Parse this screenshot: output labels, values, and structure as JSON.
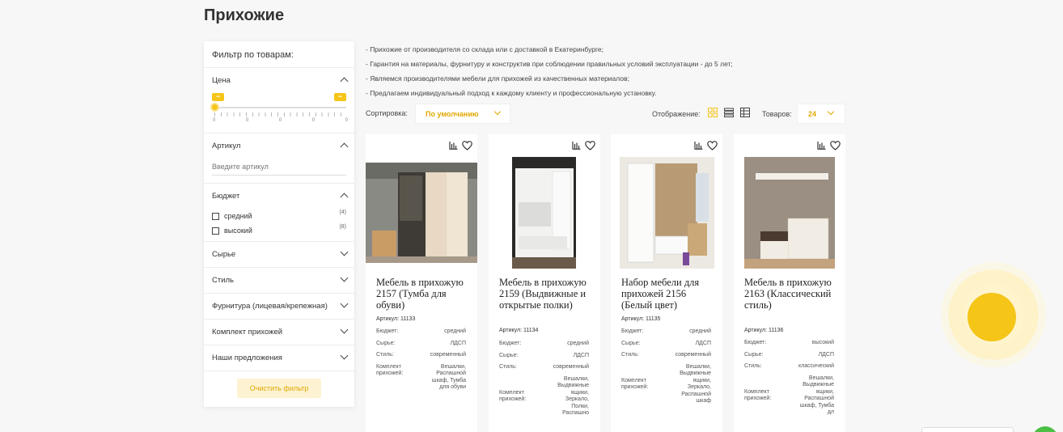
{
  "page": {
    "title": "Прихожие"
  },
  "filter": {
    "title": "Фильтр по товарам:",
    "price": {
      "label": "Цена",
      "min_tag": "▪▪",
      "max_tag": "▪▪",
      "tick_labels": [
        "0",
        "0",
        "0",
        "0",
        "0"
      ]
    },
    "sku": {
      "label": "Артикул",
      "placeholder": "Введите артикул"
    },
    "budget": {
      "label": "Бюджет",
      "options": [
        {
          "label": "средний",
          "count": "(4)"
        },
        {
          "label": "высокий",
          "count": "(8)"
        }
      ]
    },
    "collapsed_sections": [
      "Сырье",
      "Стиль",
      "Фурнитура (лицевая/крепежная)",
      "Комплект прихожей",
      "Наши предложения"
    ],
    "clear_label": "Очистить фильтр"
  },
  "description": [
    "- Прихожие от производителя со склада или с доставкой в Екатеринбурге;",
    "- Гарантия на материалы, фурнитуру и конструктив при соблюдении правильных условий эксплуатации - до 5 лет;",
    "- Являемся производителями мебели для прихожей из качественных материалов;",
    "- Предлагаем индивидуальный подход к каждому клиенту и профессиональную установку."
  ],
  "toolbar": {
    "sort_label": "Сортировка:",
    "sort_value": "По умолчанию",
    "view_label": "Отображение:",
    "per_page_label": "Товаров:",
    "per_page_value": "24"
  },
  "colors": {
    "accent": "#f5c518",
    "accent_text": "#e0a800"
  },
  "products": [
    {
      "name": "Мебель в прихожую 2157 (Тумба для обуви)",
      "sku": "Артикул: 11133",
      "props": [
        {
          "k": "Бюджет:",
          "v": "средний"
        },
        {
          "k": "Сырье:",
          "v": "ЛДСП"
        },
        {
          "k": "Стиль:",
          "v": "современный"
        },
        {
          "k": "Комплект прихожей:",
          "v": "Вешалки, Распашной шкаф, Тумба для обуви"
        }
      ]
    },
    {
      "name": "Мебель в прихожую 2159 (Выдвижные и открытые полки)",
      "sku": "Артикул: 11134",
      "props": [
        {
          "k": "Бюджет:",
          "v": "средний"
        },
        {
          "k": "Сырье:",
          "v": "ЛДСП"
        },
        {
          "k": "Стиль:",
          "v": "современный"
        },
        {
          "k": "Комплект прихожей:",
          "v": "Вешалки, Выдвижные ящики, Зеркало, Полки, Распашно"
        }
      ]
    },
    {
      "name": "Набор мебели для прихожей 2156 (Белый цвет)",
      "sku": "Артикул: 11135",
      "props": [
        {
          "k": "Бюджет:",
          "v": "средний"
        },
        {
          "k": "Сырье:",
          "v": "ЛДСП"
        },
        {
          "k": "Стиль:",
          "v": "современный"
        },
        {
          "k": "Комплект прихожей:",
          "v": "Вешалки, Выдвижные ящики, Зеркало, Распашной шкаф"
        }
      ]
    },
    {
      "name": "Мебель в прихожую 2163 (Классический стиль)",
      "sku": "Артикул: 11136",
      "props": [
        {
          "k": "Бюджет:",
          "v": "высокий"
        },
        {
          "k": "Сырье:",
          "v": "ЛДСП"
        },
        {
          "k": "Стиль:",
          "v": "классический"
        },
        {
          "k": "Комплект прихожей:",
          "v": "Вешалки, Выдвижные ящики, Распашной шкаф, Тумба дл"
        }
      ]
    }
  ]
}
